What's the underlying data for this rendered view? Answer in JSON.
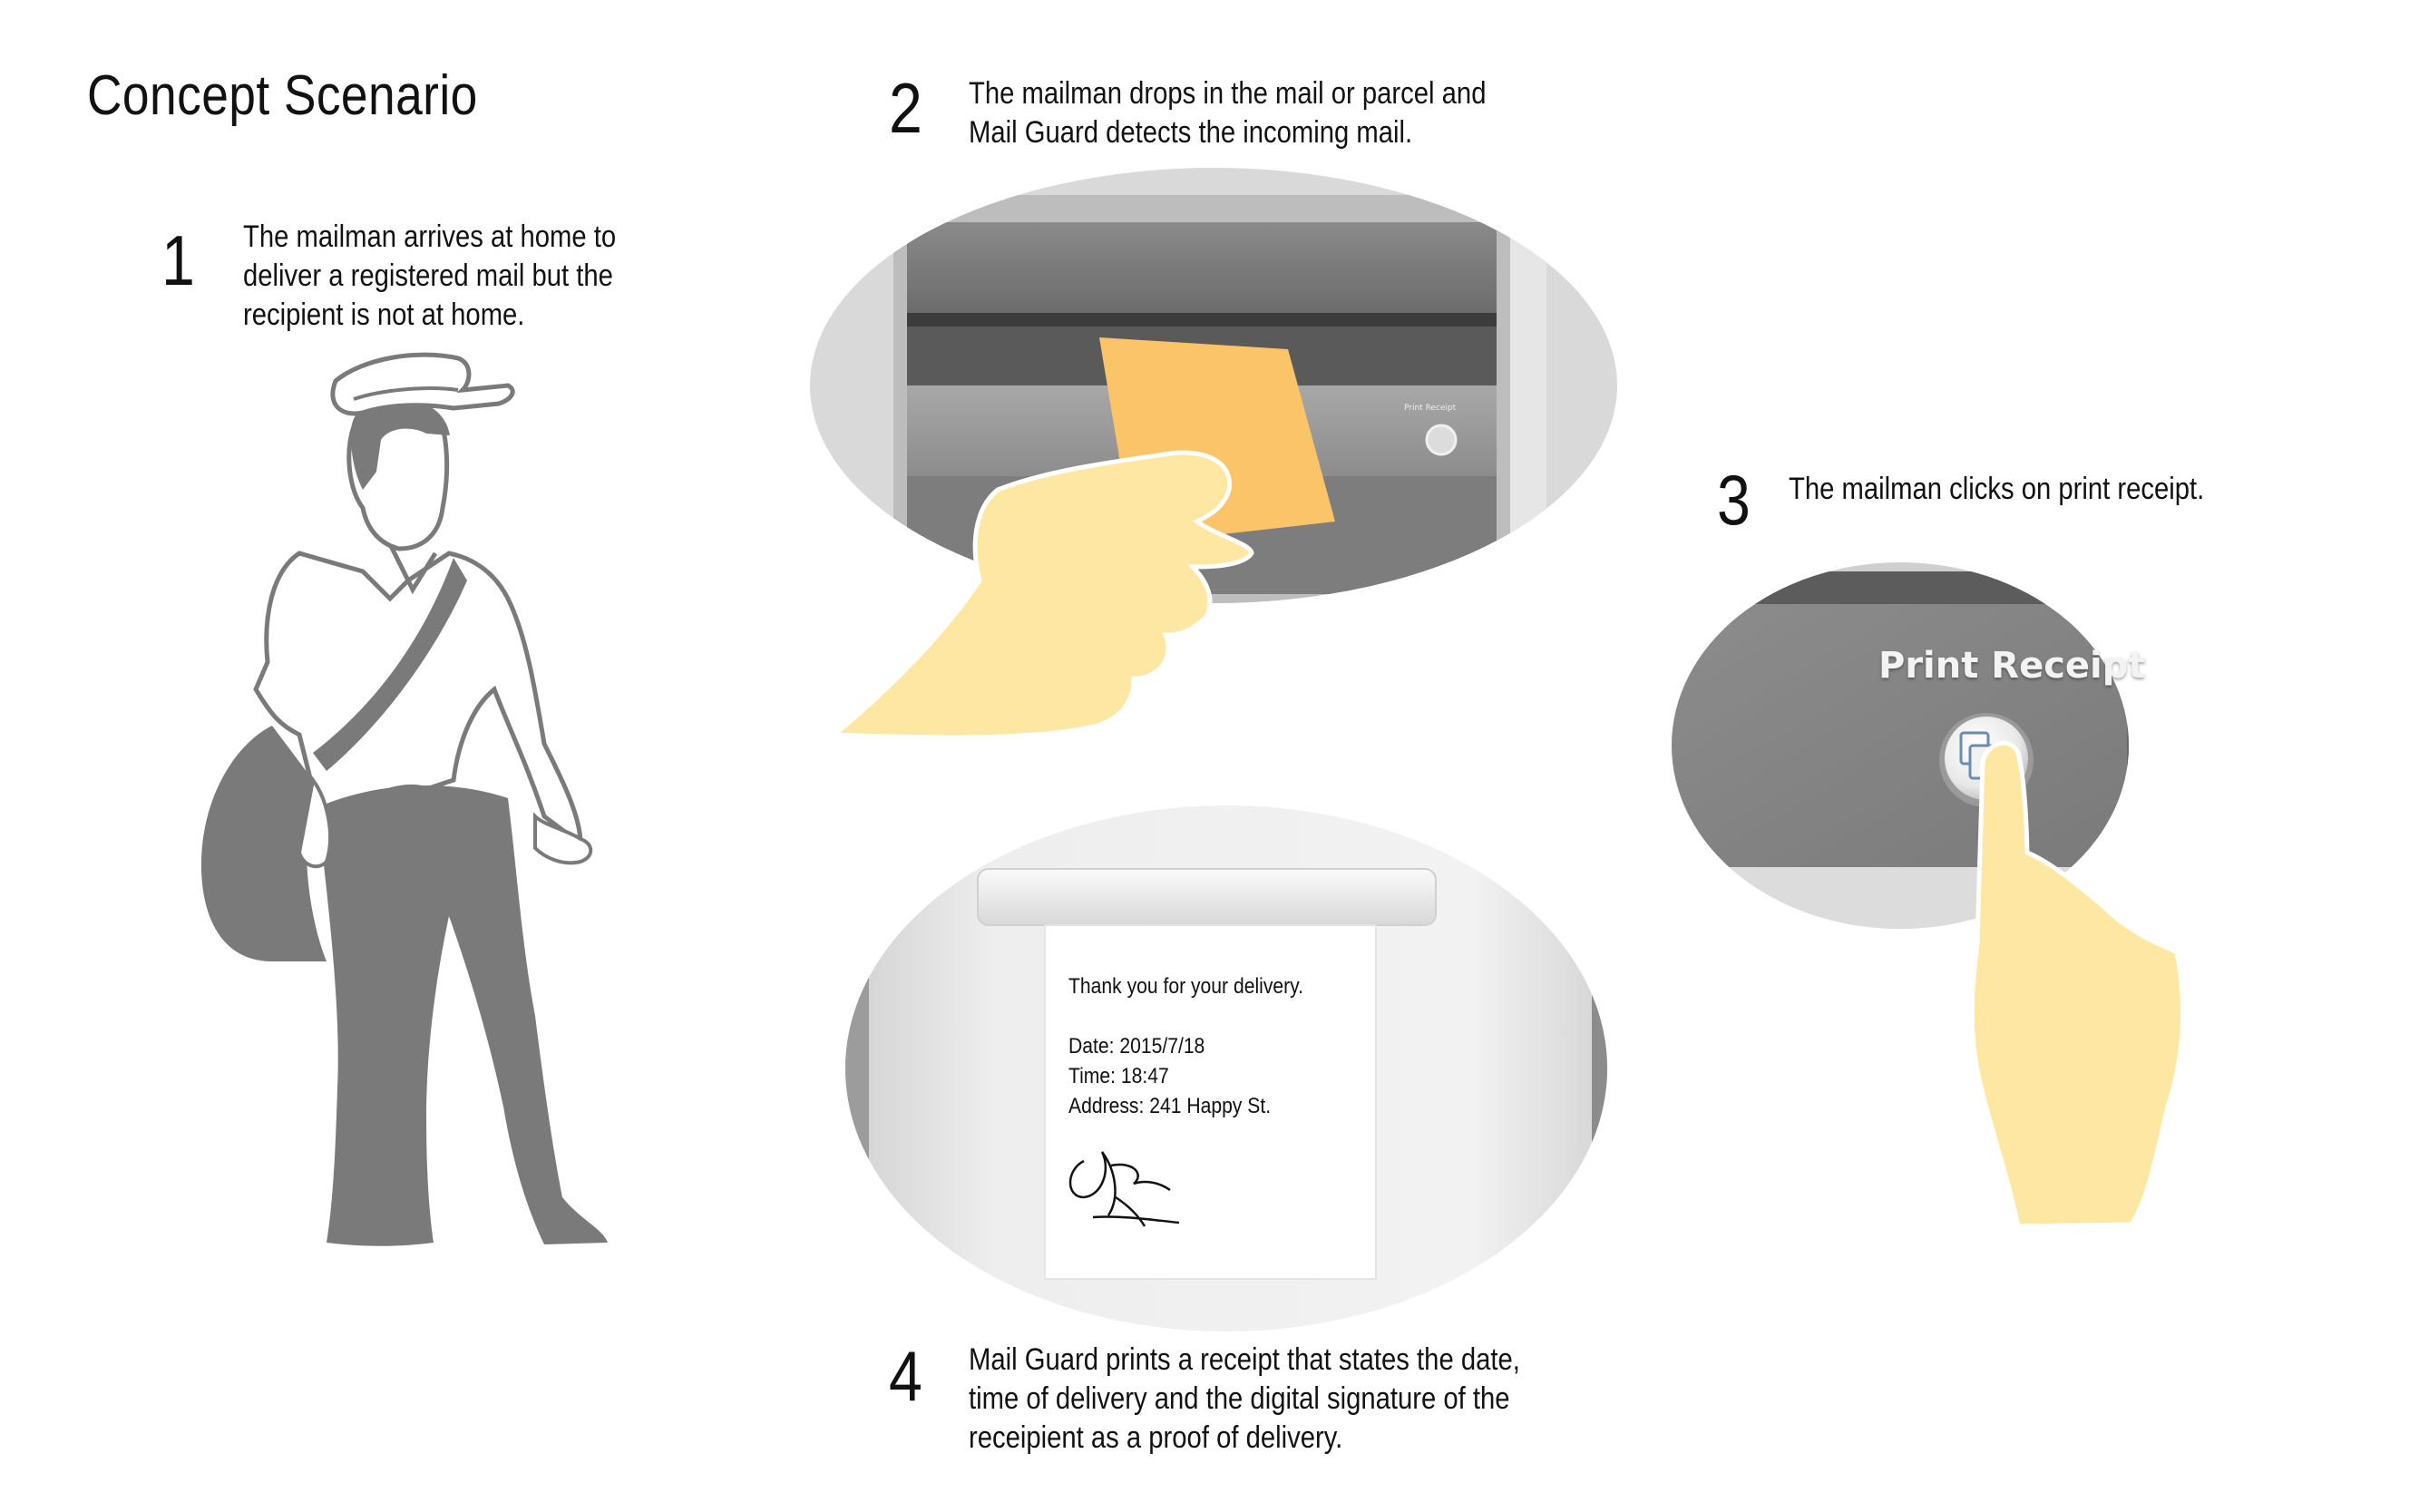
{
  "title": "Concept Scenario",
  "steps": [
    {
      "number": "1",
      "lines": [
        "The mailman arrives at home to",
        "deliver a registered mail but the",
        "recipient is not at home."
      ]
    },
    {
      "number": "2",
      "lines": [
        "The mailman drops in the mail or parcel and",
        "Mail Guard detects the incoming mail."
      ]
    },
    {
      "number": "3",
      "lines": [
        "The mailman clicks on print receipt."
      ]
    },
    {
      "number": "4",
      "lines": [
        "Mail Guard prints a receipt that states the date,",
        "time of delivery and the digital signature of the",
        "receipient as a proof of delivery."
      ]
    }
  ],
  "mailbox_panel_label": "Print Receipt",
  "button_label": "Print Receipt",
  "receipt": {
    "thanks": "Thank you for your delivery.",
    "date": "Date: 2015/7/18",
    "time": "Time: 18:47",
    "address": "Address: 241 Happy St."
  },
  "colors": {
    "hand": "#fde7a3",
    "letter": "#fcc469",
    "figure_gray": "#7a7a7a",
    "metal_dark": "#777777"
  }
}
